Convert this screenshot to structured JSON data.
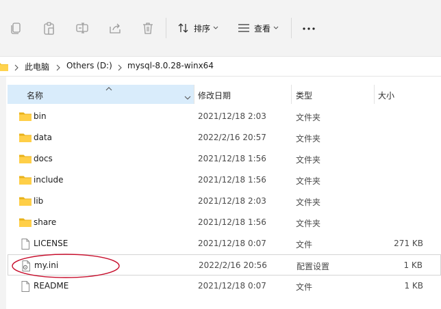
{
  "toolbar": {
    "icons": [
      "copy-icon",
      "paste-icon",
      "rename-icon",
      "share-icon",
      "delete-icon"
    ],
    "sort_label": "排序",
    "view_label": "查看"
  },
  "address": {
    "crumbs": [
      "此电脑",
      "Others (D:)",
      "mysql-8.0.28-winx64"
    ]
  },
  "columns": {
    "name": "名称",
    "date": "修改日期",
    "type": "类型",
    "size": "大小"
  },
  "files": [
    {
      "name": "bin",
      "date": "2021/12/18 2:03",
      "type": "文件夹",
      "size": "",
      "icon": "folder-icon"
    },
    {
      "name": "data",
      "date": "2022/2/16 20:57",
      "type": "文件夹",
      "size": "",
      "icon": "folder-icon"
    },
    {
      "name": "docs",
      "date": "2021/12/18 1:56",
      "type": "文件夹",
      "size": "",
      "icon": "folder-icon"
    },
    {
      "name": "include",
      "date": "2021/12/18 1:56",
      "type": "文件夹",
      "size": "",
      "icon": "folder-icon"
    },
    {
      "name": "lib",
      "date": "2021/12/18 2:03",
      "type": "文件夹",
      "size": "",
      "icon": "folder-icon"
    },
    {
      "name": "share",
      "date": "2021/12/18 1:56",
      "type": "文件夹",
      "size": "",
      "icon": "folder-icon"
    },
    {
      "name": "LICENSE",
      "date": "2021/12/18 0:07",
      "type": "文件",
      "size": "271 KB",
      "icon": "file-icon"
    },
    {
      "name": "my.ini",
      "date": "2022/2/16 20:56",
      "type": "配置设置",
      "size": "1 KB",
      "icon": "ini-file-icon"
    },
    {
      "name": "README",
      "date": "2021/12/18 0:07",
      "type": "文件",
      "size": "1 KB",
      "icon": "file-icon"
    }
  ],
  "colors": {
    "folder": "#f4c430",
    "folder_dark": "#e0a800",
    "annotation": "#c8102e",
    "header_highlight": "#d9ecfb"
  }
}
